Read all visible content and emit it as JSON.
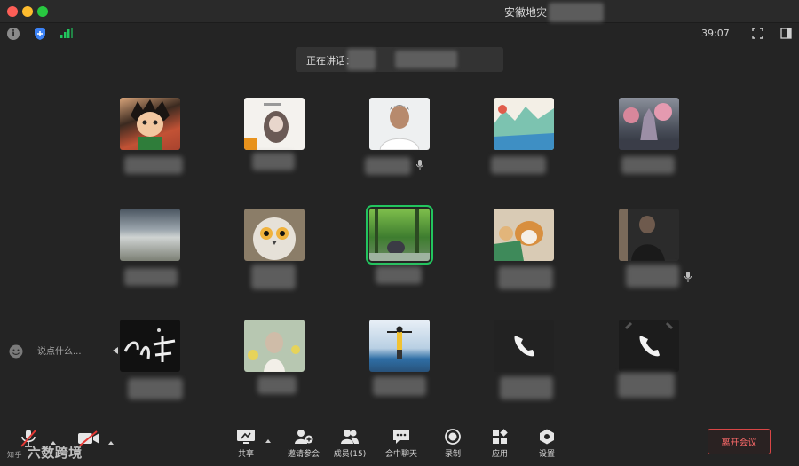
{
  "window": {
    "title": "安徽地灾"
  },
  "topbar": {
    "timer": "39:07"
  },
  "banner": {
    "label": "正在讲话："
  },
  "chat": {
    "placeholder": "说点什么..."
  },
  "toolbar": {
    "share": "共享",
    "invite": "邀请参会",
    "members": "成员(15)",
    "chat": "会中聊天",
    "record": "录制",
    "apps": "应用",
    "settings": "设置",
    "leave": "离开会议"
  },
  "watermark": {
    "text": "六数跨境",
    "prefix": "知乎"
  },
  "colors": {
    "leave": "#d94646",
    "active_border": "#22c55e",
    "background": "#242424"
  },
  "icons": [
    "info-icon",
    "shield-icon",
    "signal-icon",
    "fullscreen-icon",
    "sidebar-toggle-icon",
    "mic-icon",
    "phone-icon",
    "smile-icon",
    "share-screen-icon",
    "invite-icon",
    "members-icon",
    "chat-icon",
    "record-icon",
    "apps-icon",
    "settings-icon",
    "muted-mic-icon",
    "video-off-icon"
  ]
}
